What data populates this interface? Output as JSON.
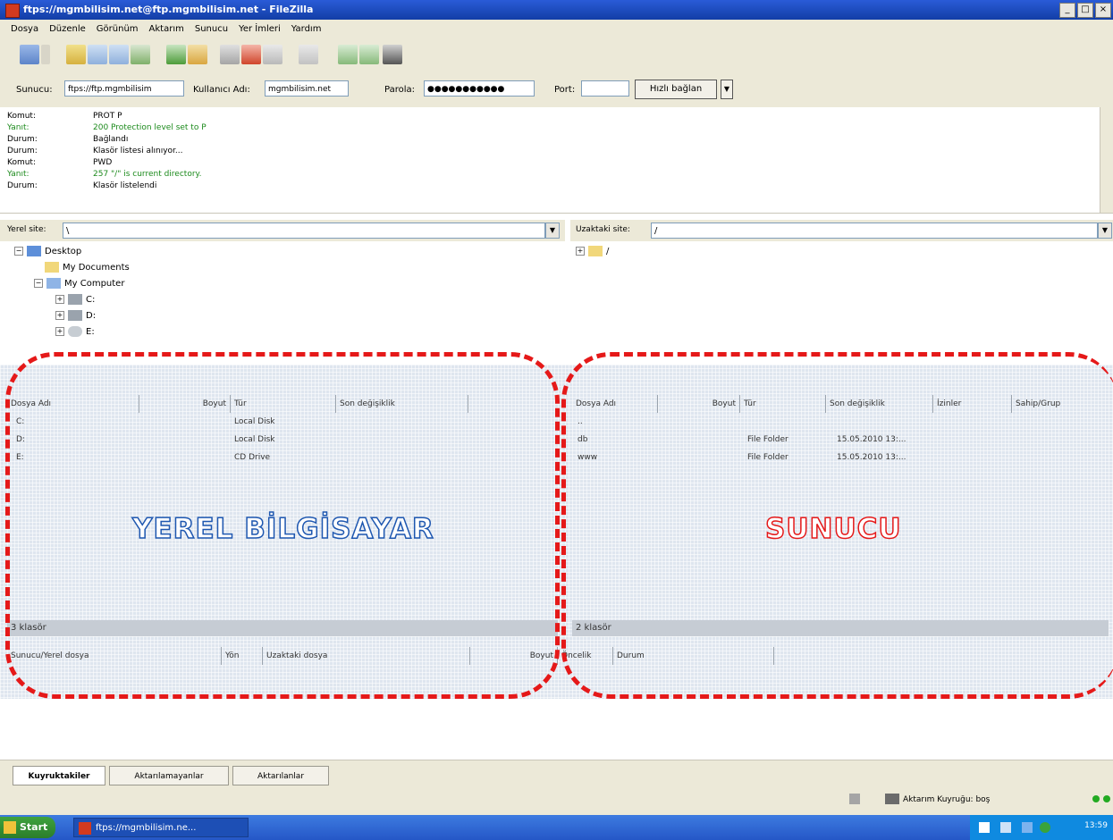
{
  "window": {
    "title": "ftps://mgmbilisim.net@ftp.mgmbilisim.net - FileZilla",
    "controls": [
      "_",
      "□",
      "×"
    ]
  },
  "menu": [
    "Dosya",
    "Düzenle",
    "Görünüm",
    "Aktarım",
    "Sunucu",
    "Yer İmleri",
    "Yardım"
  ],
  "quickconnect": {
    "host_label": "Sunucu:",
    "host_value": "ftps://ftp.mgmbilisim",
    "user_label": "Kullanıcı Adı:",
    "user_value": "mgmbilisim.net",
    "pass_label": "Parola:",
    "pass_value": "●●●●●●●●●●●",
    "port_label": "Port:",
    "port_value": "",
    "button": "Hızlı bağlan"
  },
  "log": [
    {
      "k": "Komut:",
      "v": "PROT P",
      "green": false
    },
    {
      "k": "Yanıt:",
      "v": "200 Protection level set to P",
      "green": true
    },
    {
      "k": "Durum:",
      "v": "Bağlandı",
      "green": false
    },
    {
      "k": "Durum:",
      "v": "Klasör listesi alınıyor...",
      "green": false
    },
    {
      "k": "Komut:",
      "v": "PWD",
      "green": false
    },
    {
      "k": "Yanıt:",
      "v": "257 \"/\" is current directory.",
      "green": true
    },
    {
      "k": "Durum:",
      "v": "Klasör listelendi",
      "green": false
    }
  ],
  "local": {
    "site_label": "Yerel site:",
    "site_value": "\\",
    "tree": [
      "Desktop",
      "My Documents",
      "My Computer",
      "C:",
      "D:",
      "E:"
    ],
    "columns": [
      "Dosya Adı",
      "Boyut",
      "Tür",
      "Son değişiklik"
    ],
    "files": [
      {
        "name": "C:",
        "type": "Local Disk"
      },
      {
        "name": "D:",
        "type": "Local Disk"
      },
      {
        "name": "E:",
        "type": "CD Drive"
      }
    ],
    "status": "3 klasör"
  },
  "remote": {
    "site_label": "Uzaktaki site:",
    "site_value": "/",
    "tree": [
      "/"
    ],
    "columns": [
      "Dosya Adı",
      "Boyut",
      "Tür",
      "Son değişiklik",
      "İzinler",
      "Sahip/Grup"
    ],
    "files": [
      {
        "name": "..",
        "type": "",
        "modified": ""
      },
      {
        "name": "db",
        "type": "File Folder",
        "modified": "15.05.2010 13:..."
      },
      {
        "name": "www",
        "type": "File Folder",
        "modified": "15.05.2010 13:..."
      }
    ],
    "status": "2 klasör"
  },
  "queue_columns": [
    "Sunucu/Yerel dosya",
    "Yön",
    "Uzaktaki dosya",
    "Boyut",
    "Öncelik",
    "Durum"
  ],
  "overlay": {
    "local_label": "YEREL BİLGİSAYAR",
    "remote_label": "SUNUCU"
  },
  "queue_tabs": [
    "Kuyruktakiler",
    "Aktarılamayanlar",
    "Aktarılanlar"
  ],
  "queue_status": "Aktarım Kuyruğu: boş",
  "taskbar": {
    "start": "Start",
    "item": "ftps://mgmbilisim.ne...",
    "clock": "13:59"
  },
  "colors": {
    "accent_red": "#e51919",
    "accent_blue": "#1e57b0"
  }
}
